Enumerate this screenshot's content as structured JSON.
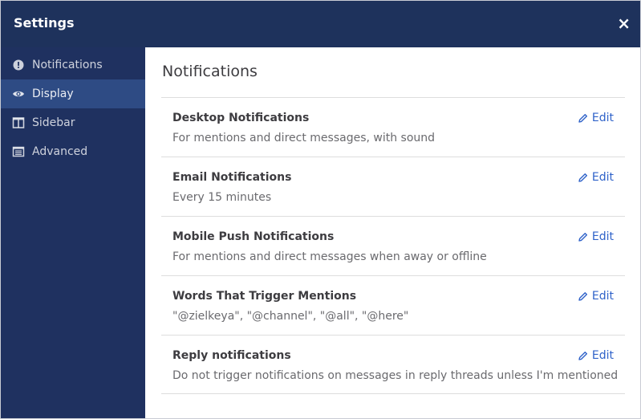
{
  "modal": {
    "title": "Settings",
    "close_glyph": "×",
    "colors": {
      "header_bg": "#1e325c",
      "sidebar_bg": "#1f3160",
      "active_item_bg": "#2e4b84",
      "link": "#2f62c9"
    }
  },
  "sidebar": {
    "items": [
      {
        "label": "Notifications",
        "icon": "exclamation-circle-icon",
        "active": false
      },
      {
        "label": "Display",
        "icon": "eye-icon",
        "active": true
      },
      {
        "label": "Sidebar",
        "icon": "columns-icon",
        "active": false
      },
      {
        "label": "Advanced",
        "icon": "list-icon",
        "active": false
      }
    ]
  },
  "main": {
    "title": "Notifications",
    "edit_label": "Edit",
    "settings": [
      {
        "title": "Desktop Notifications",
        "description": "For mentions and direct messages, with sound"
      },
      {
        "title": "Email Notifications",
        "description": "Every 15 minutes"
      },
      {
        "title": "Mobile Push Notifications",
        "description": "For mentions and direct messages when away or offline"
      },
      {
        "title": "Words That Trigger Mentions",
        "description": "\"@zielkeya\", \"@channel\", \"@all\", \"@here\""
      },
      {
        "title": "Reply notifications",
        "description": "Do not trigger notifications on messages in reply threads unless I'm mentioned"
      }
    ]
  }
}
